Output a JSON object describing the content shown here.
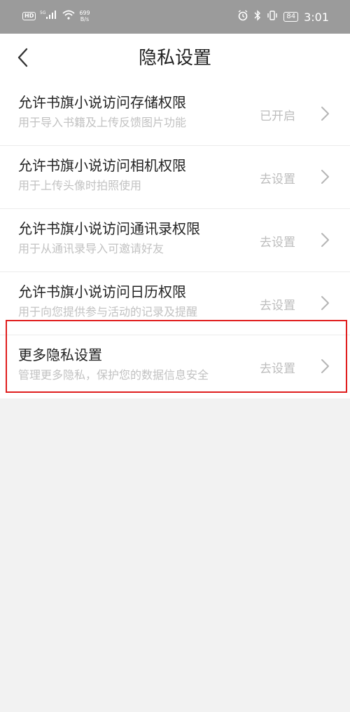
{
  "status_bar": {
    "hd_badge": "HD",
    "network": "5G",
    "net_speed_value": "699",
    "net_speed_unit": "B/s",
    "battery": "84",
    "time": "3:01"
  },
  "header": {
    "title": "隐私设置",
    "back_icon": "chevron-left-icon"
  },
  "settings": [
    {
      "title": "允许书旗小说访问存储权限",
      "desc": "用于导入书籍及上传反馈图片功能",
      "status": "已开启"
    },
    {
      "title": "允许书旗小说访问相机权限",
      "desc": "用于上传头像时拍照使用",
      "status": "去设置"
    },
    {
      "title": "允许书旗小说访问通讯录权限",
      "desc": "用于从通讯录导入可邀请好友",
      "status": "去设置"
    },
    {
      "title": "允许书旗小说访问日历权限",
      "desc": "用于向您提供参与活动的记录及提醒",
      "status": "去设置"
    },
    {
      "title": "更多隐私设置",
      "desc": "管理更多隐私，保护您的数据信息安全",
      "status": "去设置"
    }
  ],
  "colors": {
    "highlight_border": "#e01e1e",
    "status_bar_bg": "#9b9b9b",
    "secondary_text": "#c2c2c2"
  }
}
